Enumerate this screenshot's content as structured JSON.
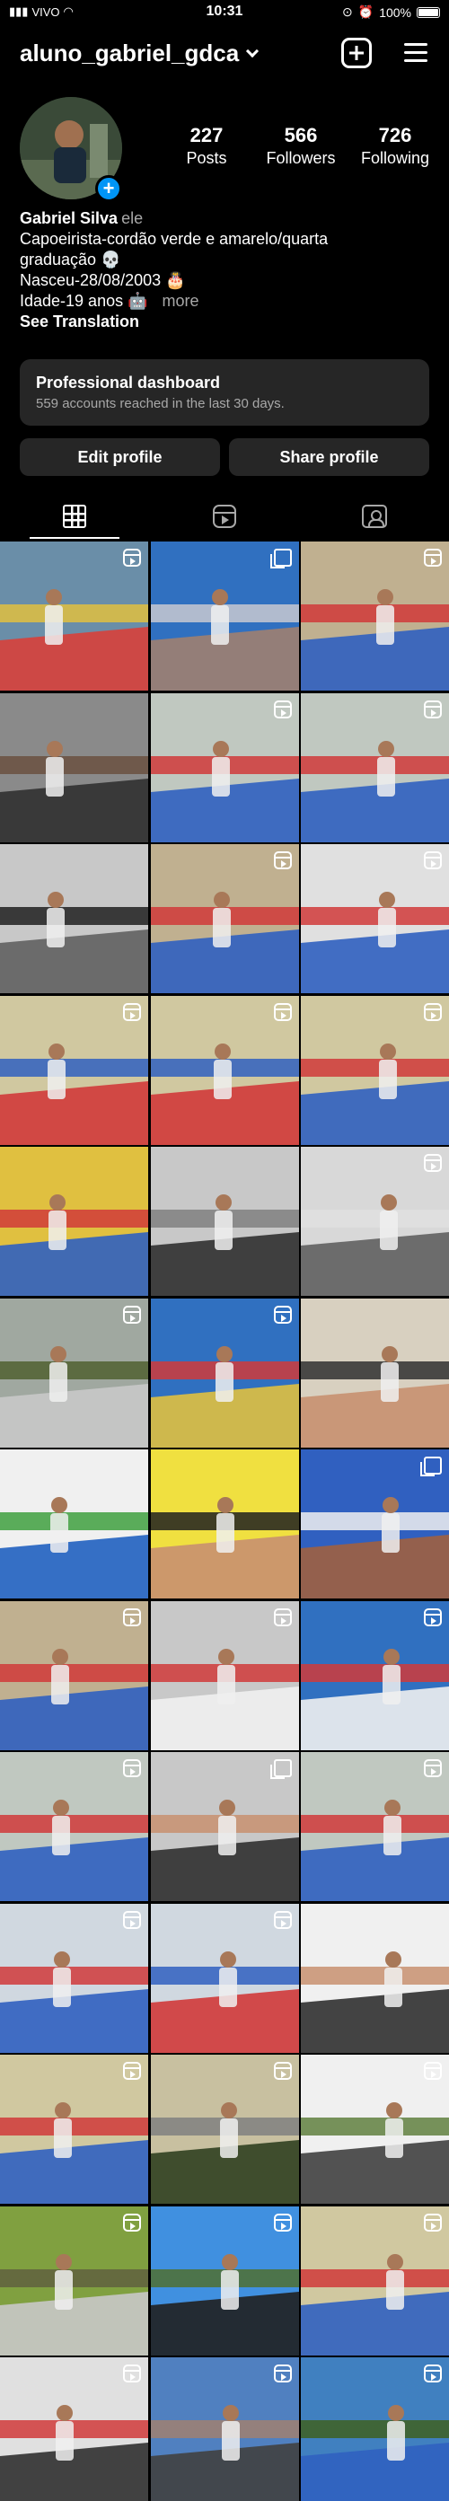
{
  "status_bar": {
    "carrier": "VIVO",
    "time": "10:31",
    "battery": "100%"
  },
  "header": {
    "username": "aluno_gabriel_gdca"
  },
  "profile": {
    "stats": [
      {
        "value": "227",
        "label": "Posts"
      },
      {
        "value": "566",
        "label": "Followers"
      },
      {
        "value": "726",
        "label": "Following"
      }
    ],
    "name": "Gabriel Silva",
    "pronoun": "ele",
    "bio_lines": [
      "Capoeirista-cordão verde e amarelo/quarta",
      "graduação 💀",
      "Nasceu-28/08/2003 🎂",
      "Idade-19 anos 🤖"
    ],
    "more_label": "more",
    "translation_label": "See Translation"
  },
  "dashboard": {
    "title": "Professional dashboard",
    "subtitle": "559 accounts reached in the last 30 days."
  },
  "buttons": {
    "edit": "Edit profile",
    "share": "Share profile"
  },
  "grid": {
    "posts": [
      {
        "colors": [
          "#6a8ea8",
          "#e0c040",
          "#d8403a"
        ],
        "badge": "reel"
      },
      {
        "colors": [
          "#3070c0",
          "#c8c8d0",
          "#a08070"
        ],
        "badge": "multi"
      },
      {
        "colors": [
          "#c0b090",
          "#d03a3a",
          "#3060c0"
        ],
        "badge": "reel"
      },
      {
        "colors": [
          "#8a8a8a",
          "#6a5040",
          "#303030"
        ],
        "badge": "none"
      },
      {
        "colors": [
          "#c0c8c0",
          "#d03a3a",
          "#3060c0"
        ],
        "badge": "reel"
      },
      {
        "colors": [
          "#c0c8c0",
          "#d03a3a",
          "#3060c0"
        ],
        "badge": "reel"
      },
      {
        "colors": [
          "#c8c8c8",
          "#202020",
          "#606060"
        ],
        "badge": "none"
      },
      {
        "colors": [
          "#c0b090",
          "#d03a3a",
          "#3060c0"
        ],
        "badge": "reel"
      },
      {
        "colors": [
          "#e0e0e0",
          "#d03a3a",
          "#3060c0"
        ],
        "badge": "reel"
      },
      {
        "colors": [
          "#d0c8a0",
          "#3060c0",
          "#d03a3a"
        ],
        "badge": "reel"
      },
      {
        "colors": [
          "#d0c8a0",
          "#3060c0",
          "#d03a3a"
        ],
        "badge": "reel"
      },
      {
        "colors": [
          "#d0c8a0",
          "#d03a3a",
          "#3060c0"
        ],
        "badge": "reel"
      },
      {
        "colors": [
          "#e0c040",
          "#d03a3a",
          "#3060c0"
        ],
        "badge": "none"
      },
      {
        "colors": [
          "#c8c8c8",
          "#808080",
          "#303030"
        ],
        "badge": "none"
      },
      {
        "colors": [
          "#d8d8d8",
          "#e0e0e0",
          "#606060"
        ],
        "badge": "reel"
      },
      {
        "colors": [
          "#a0a8a0",
          "#506030",
          "#c8c8c8"
        ],
        "badge": "reel"
      },
      {
        "colors": [
          "#3070c0",
          "#d03a3a",
          "#e0c040"
        ],
        "badge": "reel"
      },
      {
        "colors": [
          "#d8d0c0",
          "#303030",
          "#c89070"
        ],
        "badge": "none"
      },
      {
        "colors": [
          "#f0f0f0",
          "#40a040",
          "#2060c0"
        ],
        "badge": "none"
      },
      {
        "colors": [
          "#f0e040",
          "#202020",
          "#c89070"
        ],
        "badge": "none"
      },
      {
        "colors": [
          "#3060c0",
          "#f0f0f0",
          "#a06040"
        ],
        "badge": "multi"
      },
      {
        "colors": [
          "#c0b090",
          "#d03a3a",
          "#3060c0"
        ],
        "badge": "reel"
      },
      {
        "colors": [
          "#c8c8c8",
          "#d03a3a",
          "#f0f0f0"
        ],
        "badge": "reel"
      },
      {
        "colors": [
          "#3070c0",
          "#d03a3a",
          "#f0f0f0"
        ],
        "badge": "reel"
      },
      {
        "colors": [
          "#c0c8c0",
          "#d03a3a",
          "#3060c0"
        ],
        "badge": "reel"
      },
      {
        "colors": [
          "#c8c8c8",
          "#c89070",
          "#303030"
        ],
        "badge": "multi"
      },
      {
        "colors": [
          "#c0c8c0",
          "#d03a3a",
          "#3060c0"
        ],
        "badge": "reel"
      },
      {
        "colors": [
          "#d0d8e0",
          "#d03a3a",
          "#3060c0"
        ],
        "badge": "reel"
      },
      {
        "colors": [
          "#d0d8e0",
          "#3060c0",
          "#d03a3a"
        ],
        "badge": "reel"
      },
      {
        "colors": [
          "#f0f0f0",
          "#c89070",
          "#303030"
        ],
        "badge": "none"
      },
      {
        "colors": [
          "#d0c8a0",
          "#d03a3a",
          "#3060c0"
        ],
        "badge": "reel"
      },
      {
        "colors": [
          "#c8c0a0",
          "#808080",
          "#304020"
        ],
        "badge": "reel"
      },
      {
        "colors": [
          "#f0f0f0",
          "#608040",
          "#404040"
        ],
        "badge": "reel"
      },
      {
        "colors": [
          "#80a040",
          "#606040",
          "#c8c8c8"
        ],
        "badge": "reel"
      },
      {
        "colors": [
          "#4090e0",
          "#507030",
          "#202020"
        ],
        "badge": "reel"
      },
      {
        "colors": [
          "#d0c8a0",
          "#d03a3a",
          "#3060c0"
        ],
        "badge": "reel"
      },
      {
        "colors": [
          "#e0e0e0",
          "#d03a3a",
          "#303030"
        ],
        "badge": "reel"
      },
      {
        "colors": [
          "#5080c0",
          "#a08070",
          "#404040"
        ],
        "badge": "reel"
      },
      {
        "colors": [
          "#4080c0",
          "#406020",
          "#3060c0"
        ],
        "badge": "reel"
      }
    ]
  }
}
